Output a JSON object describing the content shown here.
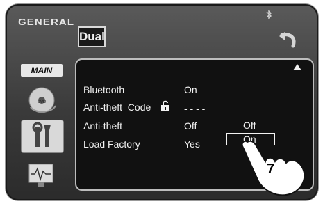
{
  "header": {
    "brand": "GENERAL",
    "logo": "Dual",
    "bluetooth_icon": "bluetooth-icon",
    "back_icon": "back-arrow-icon"
  },
  "sidebar": {
    "main_tab": "MAIN",
    "items": [
      {
        "icon": "dvd-disc-icon"
      },
      {
        "icon": "tools-icon"
      },
      {
        "icon": "monitor-waveform-icon"
      }
    ]
  },
  "settings": {
    "rows": [
      {
        "label": "Bluetooth",
        "value": "On"
      },
      {
        "label": "Anti-theft  Code",
        "value": "- - - -",
        "icon": "unlock-icon"
      },
      {
        "label": "Anti-theft",
        "value": "Off"
      },
      {
        "label": "Load Factory",
        "value": "Yes"
      }
    ],
    "scroll_up_icon": "scroll-up-icon"
  },
  "popup": {
    "options": [
      "Off",
      "On"
    ],
    "selected": "On"
  },
  "callout": {
    "step_number": "7",
    "icon": "pointing-hand-icon"
  }
}
